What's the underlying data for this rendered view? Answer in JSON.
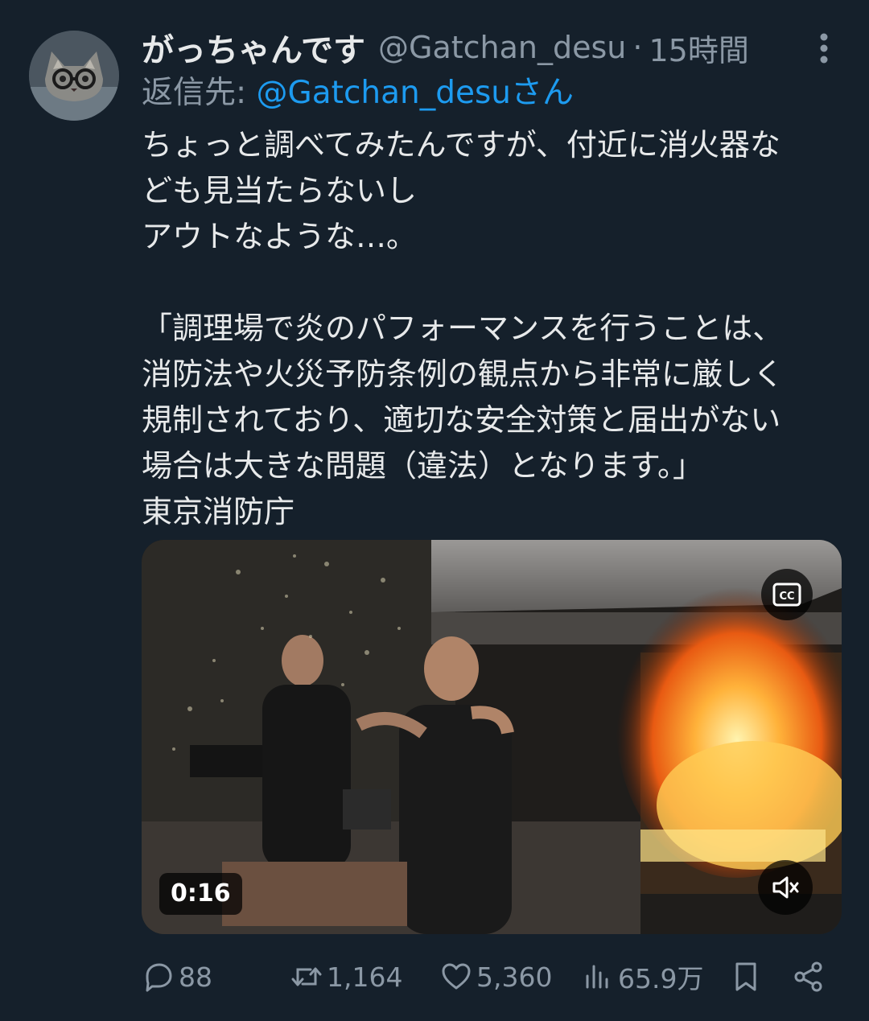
{
  "tweet": {
    "display_name": "がっちゃんです",
    "handle": "@Gatchan_desu",
    "separator": "·",
    "time": "15時間",
    "reply_label": "返信先: ",
    "reply_handle": "@Gatchan_desuさん",
    "body_lines": [
      "ちょっと調べてみたんですが、付近に消火器な",
      "ども見当たらないし",
      "アウトなような…。",
      "",
      "「調理場で炎のパフォーマンスを行うことは、",
      "消防法や火災予防条例の観点から非常に厳しく",
      "規制されており、適切な安全対策と届出がない",
      "場合は大きな問題（違法）となります。」",
      "東京消防庁"
    ]
  },
  "media": {
    "duration": "0:16",
    "cc_icon": "closed-captions-icon",
    "mute_icon": "speaker-muted-icon"
  },
  "actions": {
    "replies": "88",
    "retweets": "1,164",
    "likes": "5,360",
    "views": "65.9万",
    "icons": [
      "reply-icon",
      "retweet-icon",
      "like-icon",
      "views-icon",
      "bookmark-icon",
      "share-icon"
    ]
  },
  "colors": {
    "background": "#15202b",
    "text": "#e7e9ea",
    "secondary": "#8b98a5",
    "link": "#1d9bf0"
  }
}
